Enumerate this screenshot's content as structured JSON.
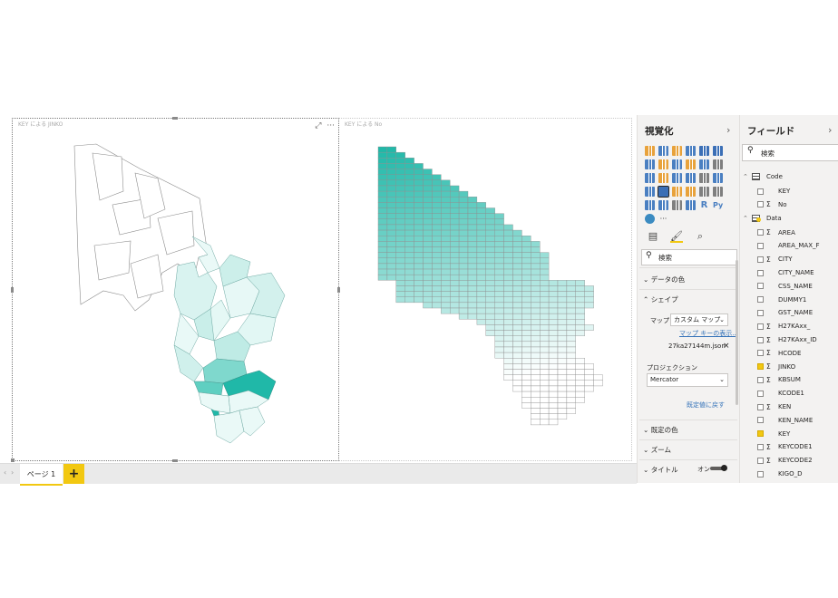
{
  "canvas": {
    "visual1_title": "KEY による JINKO",
    "visual2_title": "KEY による No"
  },
  "page_bar": {
    "tab_label": "ページ 1",
    "add_label": "+",
    "nav_prev": "‹",
    "nav_next": "›"
  },
  "viz_pane": {
    "title": "視覚化",
    "search_placeholder": "検索",
    "sections": {
      "data_colors": "データの色",
      "shape": "シェイプ",
      "default_colors": "既定の色",
      "zoom": "ズーム",
      "title": "タイトル"
    },
    "map_label": "マップ",
    "map_value": "カスタム マップ",
    "map_key_link": "マップ キーの表示...",
    "file_name": "27ka27144m.json",
    "projection_label": "プロジェクション",
    "projection_value": "Mercator",
    "reset_link": "既定値に戻す",
    "title_toggle": "オン",
    "more": "···"
  },
  "fields_pane": {
    "title": "フィールド",
    "search_placeholder": "検索",
    "tables": [
      {
        "name": "Code",
        "fields": [
          {
            "name": "KEY",
            "sigma": "",
            "checked": false
          },
          {
            "name": "No",
            "sigma": "Σ",
            "checked": false
          }
        ]
      },
      {
        "name": "Data",
        "fields": [
          {
            "name": "AREA",
            "sigma": "Σ",
            "checked": false
          },
          {
            "name": "AREA_MAX_F",
            "sigma": "",
            "checked": false
          },
          {
            "name": "CITY",
            "sigma": "Σ",
            "checked": false
          },
          {
            "name": "CITY_NAME",
            "sigma": "",
            "checked": false
          },
          {
            "name": "CSS_NAME",
            "sigma": "",
            "checked": false
          },
          {
            "name": "DUMMY1",
            "sigma": "",
            "checked": false
          },
          {
            "name": "GST_NAME",
            "sigma": "",
            "checked": false
          },
          {
            "name": "H27KAxx_",
            "sigma": "Σ",
            "checked": false
          },
          {
            "name": "H27KAxx_ID",
            "sigma": "Σ",
            "checked": false
          },
          {
            "name": "HCODE",
            "sigma": "Σ",
            "checked": false
          },
          {
            "name": "JINKO",
            "sigma": "Σ",
            "checked": true
          },
          {
            "name": "KBSUM",
            "sigma": "Σ",
            "checked": false
          },
          {
            "name": "KCODE1",
            "sigma": "",
            "checked": false
          },
          {
            "name": "KEN",
            "sigma": "Σ",
            "checked": false
          },
          {
            "name": "KEN_NAME",
            "sigma": "",
            "checked": false
          },
          {
            "name": "KEY",
            "sigma": "",
            "checked": true
          },
          {
            "name": "KEYCODE1",
            "sigma": "Σ",
            "checked": false
          },
          {
            "name": "KEYCODE2",
            "sigma": "Σ",
            "checked": false
          },
          {
            "name": "KIGO_D",
            "sigma": "",
            "checked": false
          }
        ]
      }
    ]
  },
  "colors": {
    "accent_yellow": "#f2c811",
    "map_teal": "#20b8a8",
    "map_light": "#e4f7f5",
    "link_blue": "#3271b8"
  }
}
